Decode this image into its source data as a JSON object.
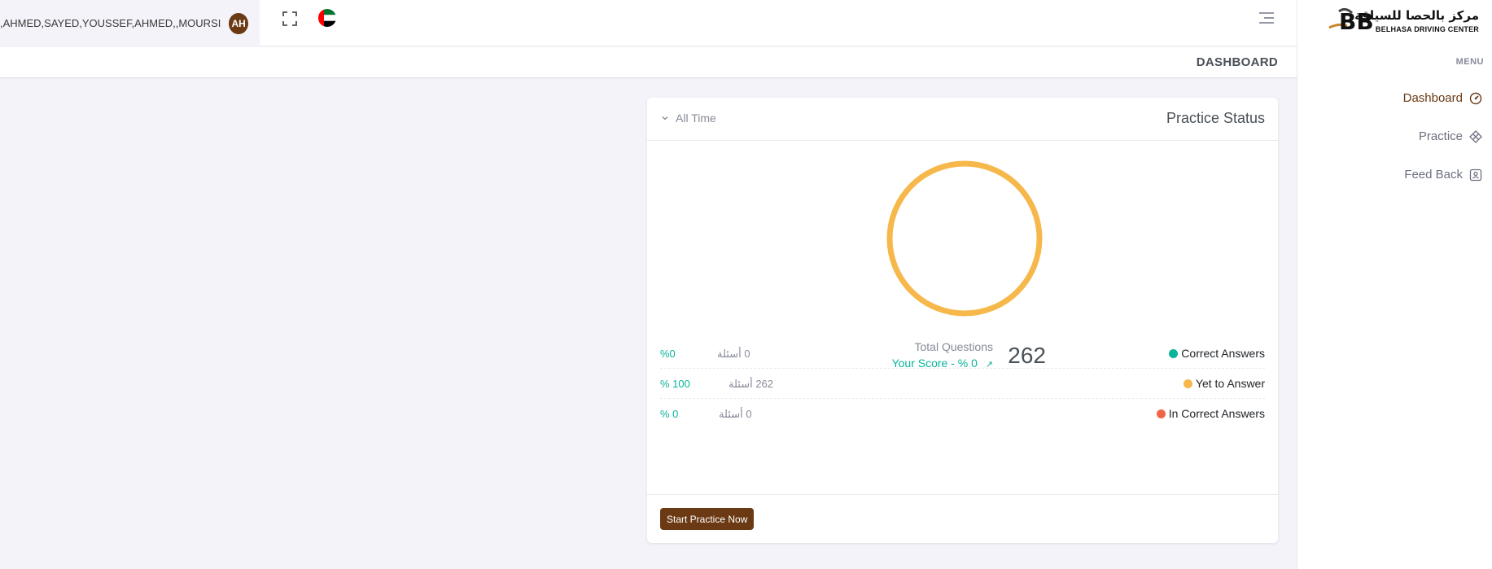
{
  "header": {
    "user_name": ",AHMED,SAYED,YOUSSEF,AHMED,,MOURSI",
    "avatar_initials": "AH"
  },
  "sidebar": {
    "logo_ar": "مركز بالحصا للسياقة",
    "logo_en": "BELHASA DRIVING CENTER",
    "menu_title": "MENU",
    "items": [
      {
        "label": "Dashboard",
        "icon": "dashboard-gauge-icon",
        "active": true
      },
      {
        "label": "Practice",
        "icon": "practice-grid-icon",
        "active": false
      },
      {
        "label": "Feed Back",
        "icon": "feedback-contact-icon",
        "active": false
      }
    ]
  },
  "page": {
    "title": "DASHBOARD"
  },
  "card": {
    "title": "Practice Status",
    "filter": "All Time",
    "total_label": "Total Questions",
    "total_value": "262",
    "score_label": "Your Score - % 0",
    "stats": [
      {
        "label": "Correct Answers",
        "count": "0 أسئلة",
        "pct": "%0",
        "color": "#0ab39c"
      },
      {
        "label": "Yet to Answer",
        "count": "262 أسئلة",
        "pct": "% 100",
        "color": "#f7b84b"
      },
      {
        "label": "In Correct Answers",
        "count": "0 أسئلة",
        "pct": "% 0",
        "color": "#f06548"
      }
    ],
    "button": "Start Practice Now"
  },
  "colors": {
    "brand": "#6b3a14",
    "success": "#0ab39c",
    "warning": "#f7b84b",
    "danger": "#f06548"
  }
}
